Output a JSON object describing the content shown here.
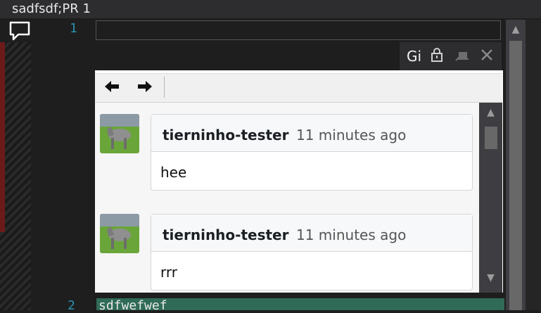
{
  "title": "sadfsdf;PR 1",
  "editor": {
    "line1_number": "1",
    "line2_number": "2",
    "line2_text": "sdfwefwef"
  },
  "tool_window": {
    "title": "Gi",
    "icons": [
      "lock-icon",
      "pin-icon",
      "close-icon"
    ]
  },
  "toolbar": {
    "back_icon": "arrow-left-icon",
    "forward_icon": "arrow-right-icon"
  },
  "comments": [
    {
      "author": "tierninho-tester",
      "time": "11 minutes ago",
      "body": "hee"
    },
    {
      "author": "tierninho-tester",
      "time": "11 minutes ago",
      "body": "rrr"
    }
  ],
  "colors": {
    "editor_bg": "#1e1e1e",
    "line_number": "#2b91af",
    "highlight_line": "#2f6b57"
  }
}
